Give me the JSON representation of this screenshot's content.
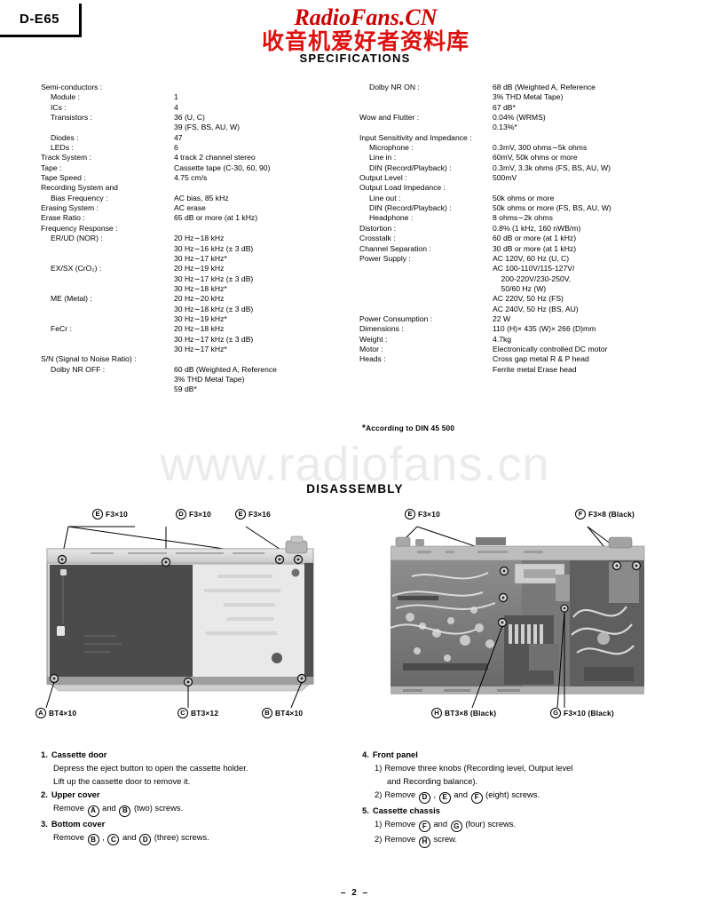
{
  "model": "D-E65",
  "page_number": "– 2 –",
  "watermark": {
    "top_line1": "RadioFans.CN",
    "top_line2": "收音机爱好者资料库",
    "middle": "www.radiofans.cn",
    "brand_color": "#cc0000",
    "middle_color": "#ebebeb"
  },
  "sections": {
    "specifications_title": "SPECIFICATIONS",
    "disassembly_title": "DISASSEMBLY"
  },
  "specs_left": [
    {
      "term": "Semi-conductors :",
      "indent": 0,
      "value": ""
    },
    {
      "term": "Module :",
      "indent": 1,
      "value": "1"
    },
    {
      "term": "ICs :",
      "indent": 1,
      "value": "4"
    },
    {
      "term": "Transistors :",
      "indent": 1,
      "value": "36 (U, C)"
    },
    {
      "term": "",
      "indent": 1,
      "value": "39 (FS, BS, AU, W)"
    },
    {
      "term": "Diodes :",
      "indent": 1,
      "value": "47"
    },
    {
      "term": "LEDs :",
      "indent": 1,
      "value": "6"
    },
    {
      "term": "Track System :",
      "indent": 0,
      "value": "4 track 2 channel stereo"
    },
    {
      "term": "Tape :",
      "indent": 0,
      "value": "Cassette tape (C-30, 60, 90)"
    },
    {
      "term": "Tape Speed :",
      "indent": 0,
      "value": "4.75 cm/s"
    },
    {
      "term": "Recording System and",
      "indent": 0,
      "value": ""
    },
    {
      "term": "Bias Frequency :",
      "indent": 1,
      "value": "AC bias, 85 kHz"
    },
    {
      "term": "Erasing System :",
      "indent": 0,
      "value": "AC erase"
    },
    {
      "term": "Erase Ratio :",
      "indent": 0,
      "value": "65 dB or more (at 1 kHz)"
    },
    {
      "term": "Frequency Response :",
      "indent": 0,
      "value": ""
    },
    {
      "term": "ER/UD (NOR) :",
      "indent": 1,
      "value": "20 Hz∼18 kHz"
    },
    {
      "term": "",
      "indent": 1,
      "value": "30 Hz∼16 kHz (± 3 dB)"
    },
    {
      "term": "",
      "indent": 1,
      "value": "30 Hz∼17 kHz*"
    },
    {
      "term": "EX/SX (CrO₂) :",
      "indent": 1,
      "value": "20 Hz∼19 kHz"
    },
    {
      "term": "",
      "indent": 1,
      "value": "30 Hz∼17 kHz (± 3 dB)"
    },
    {
      "term": "",
      "indent": 1,
      "value": "30 Hz∼18 kHz*"
    },
    {
      "term": "ME (Metal) :",
      "indent": 1,
      "value": "20 Hz∼20 kHz"
    },
    {
      "term": "",
      "indent": 1,
      "value": "30 Hz∼18 kHz (± 3 dB)"
    },
    {
      "term": "",
      "indent": 1,
      "value": "30 Hz∼19 kHz*"
    },
    {
      "term": "FeCr :",
      "indent": 1,
      "value": "20 Hz∼18 kHz"
    },
    {
      "term": "",
      "indent": 1,
      "value": "30 Hz∼17 kHz (± 3 dB)"
    },
    {
      "term": "",
      "indent": 1,
      "value": "30 Hz∼17 kHz*"
    },
    {
      "term": "S/N (Signal to Noise Ratio) :",
      "indent": 0,
      "value": ""
    },
    {
      "term": "Dolby NR OFF :",
      "indent": 1,
      "value": "60 dB (Weighted A, Reference"
    },
    {
      "term": "",
      "indent": 1,
      "value": "3% THD Metal Tape)"
    },
    {
      "term": "",
      "indent": 1,
      "value": "59 dB*"
    }
  ],
  "specs_right": [
    {
      "term": "Dolby NR ON :",
      "indent": 1,
      "value": "68 dB (Weighted A, Reference"
    },
    {
      "term": "",
      "indent": 1,
      "value": "3% THD Metal Tape)"
    },
    {
      "term": "",
      "indent": 1,
      "value": "67 dB*"
    },
    {
      "term": "Wow and Flutter :",
      "indent": 0,
      "value": "0.04% (WRMS)"
    },
    {
      "term": "",
      "indent": 0,
      "value": "0.13%*"
    },
    {
      "term": "Input Sensitivity and Impedance :",
      "indent": 0,
      "value": ""
    },
    {
      "term": "Microphone :",
      "indent": 1,
      "value": "0.3mV, 300 ohms∼5k ohms"
    },
    {
      "term": "Line in :",
      "indent": 1,
      "value": "60mV, 50k ohms or more"
    },
    {
      "term": "DIN (Record/Playback) :",
      "indent": 1,
      "value": "0.3mV, 3.3k ohms (FS, BS, AU, W)"
    },
    {
      "term": "Output Level :",
      "indent": 0,
      "value": "500mV"
    },
    {
      "term": "Output Load Impedance :",
      "indent": 0,
      "value": ""
    },
    {
      "term": "Line out :",
      "indent": 1,
      "value": "50k ohms or more"
    },
    {
      "term": "DIN (Record/Playback) :",
      "indent": 1,
      "value": "50k ohms or more (FS, BS, AU, W)"
    },
    {
      "term": "Headphone :",
      "indent": 1,
      "value": "8 ohms∼2k ohms"
    },
    {
      "term": "Distortion :",
      "indent": 0,
      "value": "0.8% (1 kHz, 160 nWB/m)"
    },
    {
      "term": "Crosstalk :",
      "indent": 0,
      "value": "60 dB or more (at 1 kHz)"
    },
    {
      "term": "Channel Separation :",
      "indent": 0,
      "value": "30 dB or more (at 1 kHz)"
    },
    {
      "term": "Power Supply :",
      "indent": 0,
      "value": "AC 120V, 60 Hz (U, C)"
    },
    {
      "term": "",
      "indent": 0,
      "value": "AC 100-110V/115-127V/"
    },
    {
      "term": "",
      "indent": 0,
      "value": "    200-220V/230-250V,"
    },
    {
      "term": "",
      "indent": 0,
      "value": "    50/60 Hz (W)"
    },
    {
      "term": "",
      "indent": 0,
      "value": "AC 220V, 50 Hz (FS)"
    },
    {
      "term": "",
      "indent": 0,
      "value": "AC 240V, 50 Hz (BS, AU)"
    },
    {
      "term": "Power Consumption :",
      "indent": 0,
      "value": "22 W"
    },
    {
      "term": "Dimensions :",
      "indent": 0,
      "value": "110 (H)× 435 (W)× 266 (D)mm"
    },
    {
      "term": "Weight :",
      "indent": 0,
      "value": "4.7kg"
    },
    {
      "term": "Motor :",
      "indent": 0,
      "value": "Electronically controlled DC motor"
    },
    {
      "term": "Heads :",
      "indent": 0,
      "value": "Cross gap metal R & P head"
    },
    {
      "term": "",
      "indent": 0,
      "value": "Ferrite metal Erase head"
    }
  ],
  "din_note": "According to DIN 45 500",
  "diagram_left": {
    "top_callouts": [
      {
        "ref": "E",
        "text": "F3×10"
      },
      {
        "ref": "D",
        "text": "F3×10"
      },
      {
        "ref": "E",
        "text": "F3×16"
      }
    ],
    "bottom_callouts": [
      {
        "ref": "A",
        "text": "BT4×10"
      },
      {
        "ref": "C",
        "text": "BT3×12"
      },
      {
        "ref": "B",
        "text": "BT4×10"
      }
    ]
  },
  "diagram_right": {
    "top_callouts": [
      {
        "ref": "E",
        "text": "F3×10"
      },
      {
        "ref": "F",
        "text": "F3×8 (Black)"
      }
    ],
    "bottom_callouts": [
      {
        "ref": "H",
        "text": "BT3×8 (Black)"
      },
      {
        "ref": "G",
        "text": "F3×10 (Black)"
      }
    ]
  },
  "steps_left": [
    {
      "num": "1.",
      "title": "Cassette door",
      "lines": [
        "Depress the eject button to open the cassette holder.",
        "Lift up the cassette door to remove it."
      ]
    },
    {
      "num": "2.",
      "title": "Upper cover",
      "parts": [
        {
          "t": "Remove "
        },
        {
          "c": "A"
        },
        {
          "t": " and "
        },
        {
          "c": "B"
        },
        {
          "t": " (two) screws."
        }
      ]
    },
    {
      "num": "3.",
      "title": "Bottom cover",
      "parts": [
        {
          "t": "Remove "
        },
        {
          "c": "B"
        },
        {
          "t": " , "
        },
        {
          "c": "C"
        },
        {
          "t": " and "
        },
        {
          "c": "D"
        },
        {
          "t": " (three) screws."
        }
      ]
    }
  ],
  "steps_right": [
    {
      "num": "4.",
      "title": "Front panel",
      "subs": [
        {
          "label": "1)",
          "lines": [
            "Remove  three  knobs  (Recording  level,  Output  level",
            "and Recording balance)."
          ]
        },
        {
          "label": "2)",
          "parts": [
            {
              "t": "Remove "
            },
            {
              "c": "D"
            },
            {
              "t": " , "
            },
            {
              "c": "E"
            },
            {
              "t": " and "
            },
            {
              "c": "F"
            },
            {
              "t": " (eight) screws."
            }
          ]
        }
      ]
    },
    {
      "num": "5.",
      "title": "Cassette chassis",
      "subs": [
        {
          "label": "1)",
          "parts": [
            {
              "t": "Remove "
            },
            {
              "c": "F"
            },
            {
              "t": " and "
            },
            {
              "c": "G"
            },
            {
              "t": " (four) screws."
            }
          ]
        },
        {
          "label": "2)",
          "parts": [
            {
              "t": "Remove "
            },
            {
              "c": "H"
            },
            {
              "t": " screw."
            }
          ]
        }
      ]
    }
  ]
}
